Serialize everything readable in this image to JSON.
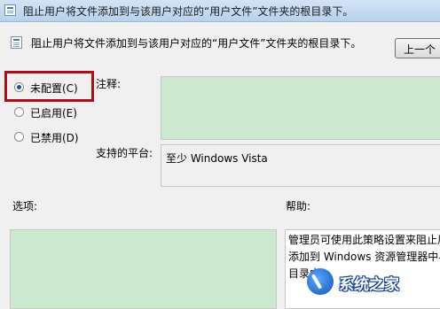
{
  "window": {
    "title": "阻止用户将文件添加到与该用户对应的“用户文件”文件夹的根目录下。"
  },
  "header": {
    "policy_name": "阻止用户将文件添加到与该用户对应的“用户文件”文件夹的根目录下。",
    "prev_button_label": "上一个"
  },
  "state_options": [
    {
      "label": "未配置(C)",
      "checked": true
    },
    {
      "label": "已启用(E)",
      "checked": false
    },
    {
      "label": "已禁用(D)",
      "checked": false
    }
  ],
  "comment": {
    "label": "注释:",
    "value": ""
  },
  "platform": {
    "label": "支持的平台:",
    "value": "至少 Windows Vista"
  },
  "options_section": {
    "label": "选项:"
  },
  "help_section": {
    "label": "帮助:",
    "lines": [
      "管理员可使用此策略设置来阻止用",
      "添加到 Windows 资源管理器中与",
      "目录中。"
    ]
  },
  "watermark": {
    "text": "系统之家"
  },
  "colors": {
    "highlight_border": "#a3131b",
    "disabled_field_bg": "#cce8cf"
  }
}
